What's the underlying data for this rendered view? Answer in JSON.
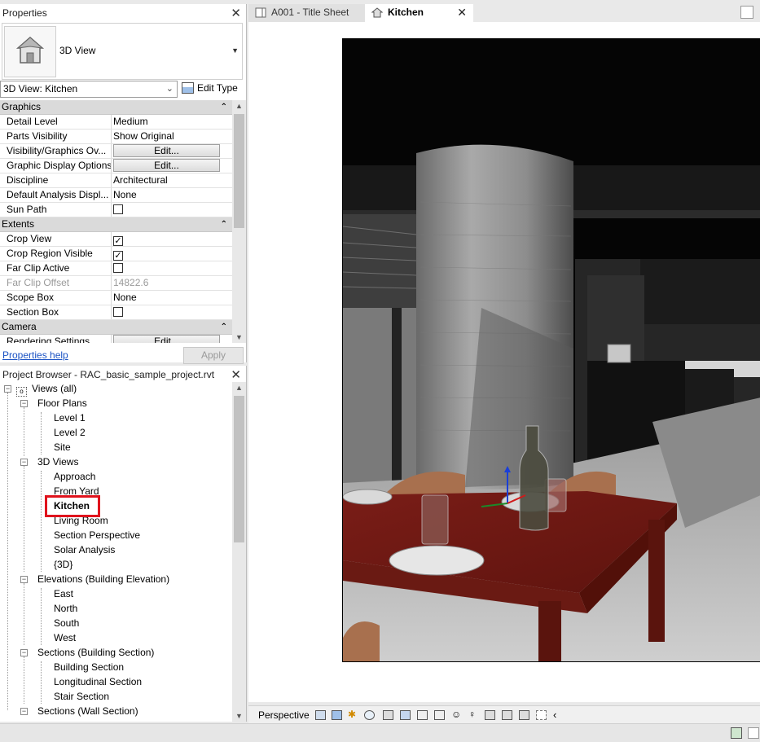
{
  "properties": {
    "title": "Properties",
    "type_name": "3D View",
    "instance_selector": "3D View: Kitchen",
    "edit_type": "Edit Type",
    "categories": {
      "graphics": "Graphics",
      "extents": "Extents",
      "camera": "Camera"
    },
    "graphics_rows": [
      {
        "label": "Detail Level",
        "value": "Medium"
      },
      {
        "label": "Parts Visibility",
        "value": "Show Original"
      },
      {
        "label": "Visibility/Graphics Ov...",
        "value": "Edit..."
      },
      {
        "label": "Graphic Display Options",
        "value": "Edit..."
      },
      {
        "label": "Discipline",
        "value": "Architectural"
      },
      {
        "label": "Default Analysis Displ...",
        "value": "None"
      },
      {
        "label": "Sun Path",
        "value": ""
      }
    ],
    "extents_rows": [
      {
        "label": "Crop View",
        "value": ""
      },
      {
        "label": "Crop Region Visible",
        "value": ""
      },
      {
        "label": "Far Clip Active",
        "value": ""
      },
      {
        "label": "Far Clip Offset",
        "value": "14822.6"
      },
      {
        "label": "Scope Box",
        "value": "None"
      },
      {
        "label": "Section Box",
        "value": ""
      }
    ],
    "camera_rows": [
      {
        "label": "Rendering Settings",
        "value": "Edit..."
      }
    ],
    "help_link": "Properties help",
    "apply": "Apply"
  },
  "browser": {
    "title": "Project Browser - RAC_basic_sample_project.rvt",
    "root": "Views (all)",
    "floor_plans": "Floor Plans",
    "floor_plan_items": [
      "Level 1",
      "Level 2",
      "Site"
    ],
    "views_3d": "3D Views",
    "views_3d_items": [
      "Approach",
      "From Yard",
      "Kitchen",
      "Living Room",
      "Section Perspective",
      "Solar Analysis",
      "{3D}"
    ],
    "elevations": "Elevations (Building Elevation)",
    "elevation_items": [
      "East",
      "North",
      "South",
      "West"
    ],
    "sections_building": "Sections (Building Section)",
    "section_items": [
      "Building Section",
      "Longitudinal Section",
      "Stair Section"
    ],
    "sections_wall": "Sections (Wall Section)"
  },
  "tabs": [
    {
      "label": "A001 - Title Sheet"
    },
    {
      "label": "Kitchen"
    }
  ],
  "viewbar": {
    "mode": "Perspective"
  }
}
